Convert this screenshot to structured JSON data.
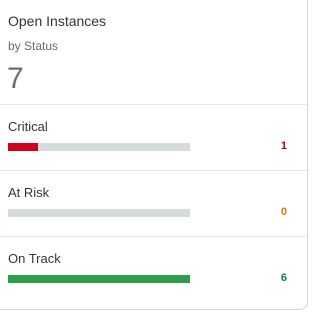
{
  "card": {
    "title": "Open Instances",
    "subtitle": "by Status",
    "total": "7"
  },
  "statuses": [
    {
      "label": "Critical",
      "value": "1",
      "fill_fraction": 0.1667,
      "color": "#d0021b",
      "value_color": "#bb0000"
    },
    {
      "label": "At Risk",
      "value": "0",
      "fill_fraction": 0.0,
      "color": "#e9730c",
      "value_color": "#e9730c"
    },
    {
      "label": "On Track",
      "value": "6",
      "fill_fraction": 1.0,
      "color": "#2b9f4a",
      "value_color": "#107e3e"
    }
  ],
  "colors": {
    "track": "#d5dadd",
    "title_text": "#32363a",
    "muted_text": "#6a6d70"
  }
}
